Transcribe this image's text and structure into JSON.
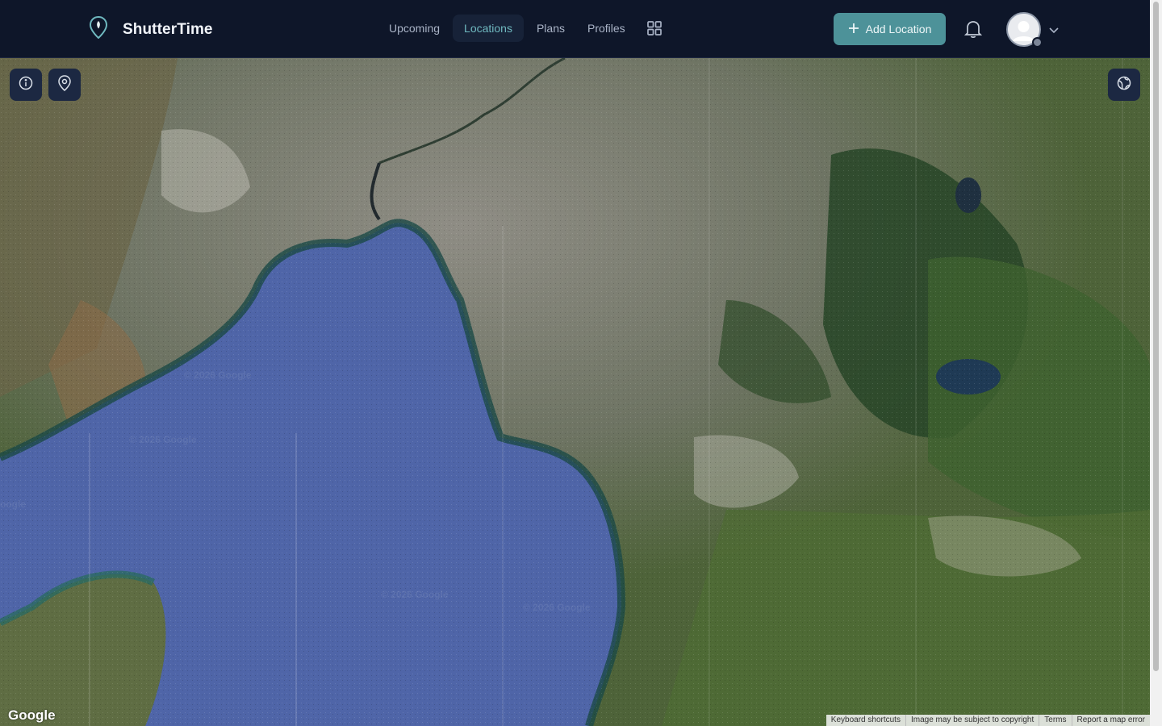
{
  "app": {
    "name": "ShutterTime",
    "logo_icon": "map-pin-icon"
  },
  "nav": {
    "items": [
      {
        "label": "Upcoming",
        "active": false
      },
      {
        "label": "Locations",
        "active": true
      },
      {
        "label": "Plans",
        "active": false
      },
      {
        "label": "Profiles",
        "active": false
      }
    ],
    "apps_icon": "grid-icon"
  },
  "header": {
    "add_button_label": "Add Location",
    "add_icon": "plus-icon",
    "bell_icon": "bell-icon",
    "avatar_icon": "user-avatar",
    "menu_icon": "chevron-down-icon"
  },
  "map": {
    "controls": {
      "info_icon": "info-icon",
      "location_icon": "location-pin-icon",
      "globe_icon": "globe-icon"
    },
    "provider_logo": "Google",
    "watermarks": [
      "© 2026 Google",
      "© 2026 Google",
      "© 2026 Google",
      "© 2026 Google",
      "oogle"
    ],
    "attribution": [
      "Keyboard shortcuts",
      "Image may be subject to copyright",
      "Terms",
      "Report a map error"
    ]
  },
  "colors": {
    "header_bg": "#0e1629",
    "accent": "#4d9299",
    "active_nav_text": "#6fb8bf",
    "water": "#4f65a8"
  }
}
